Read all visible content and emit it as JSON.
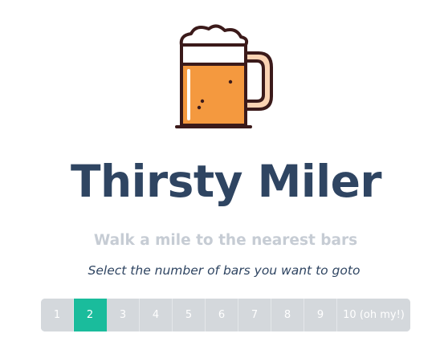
{
  "brand": {
    "title": "Thirsty Miler",
    "tagline": "Walk a mile to the nearest bars",
    "logo_icon": "beer-mug-icon"
  },
  "picker": {
    "prompt": "Select the number of bars you want to goto",
    "selected_index": 1,
    "options": [
      "1",
      "2",
      "3",
      "4",
      "5",
      "6",
      "7",
      "8",
      "9",
      "10 (oh my!)"
    ]
  },
  "colors": {
    "title": "#2f4562",
    "tagline": "#c6ccd4",
    "button_bg": "#d4d8dc",
    "button_active": "#1abc9c",
    "beer": "#f4993f",
    "handle": "#fbd3b3",
    "outline": "#3b1a1a"
  }
}
